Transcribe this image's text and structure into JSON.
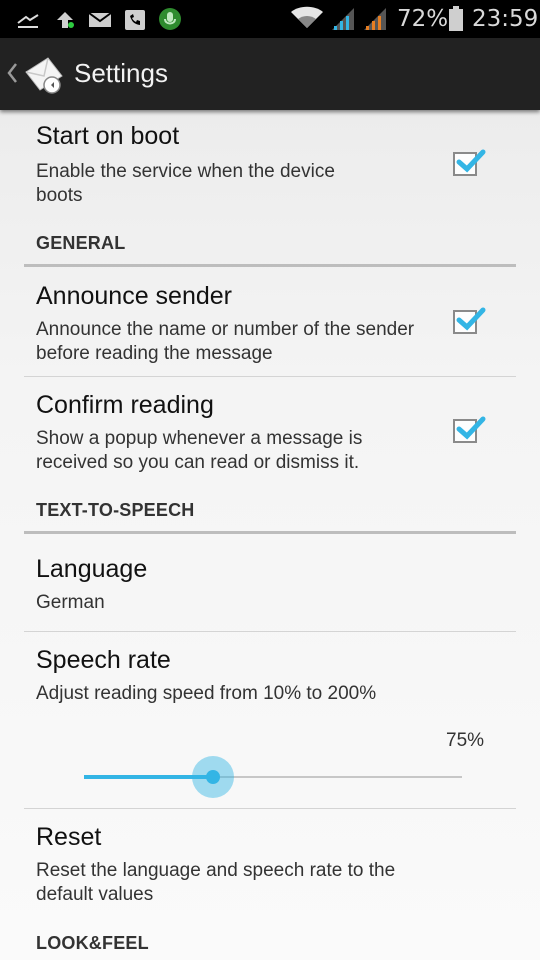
{
  "status_bar": {
    "battery": "72%",
    "time": "23:59",
    "icons": [
      "usb-icon",
      "upload-icon",
      "mail-icon",
      "voicemail-icon",
      "mic-icon",
      "wifi-icon",
      "signal-icon",
      "signal-icon",
      "battery-icon"
    ]
  },
  "action_bar": {
    "title": "Settings",
    "icons": [
      "back-chevron-icon",
      "app-logo-icon"
    ]
  },
  "preferences": {
    "start_on_boot": {
      "title": "Start on boot",
      "summary": "Enable the service when the device boots",
      "checked": true
    },
    "general_header": "GENERAL",
    "announce_sender": {
      "title": "Announce sender",
      "summary": "Announce the name or number of the sender before reading the message",
      "checked": true
    },
    "confirm_reading": {
      "title": "Confirm reading",
      "summary": "Show a popup whenever a message is received so you can read or dismiss it.",
      "checked": true
    },
    "tts_header": "TEXT-TO-SPEECH",
    "language": {
      "title": "Language",
      "summary": "German"
    },
    "speech_rate": {
      "title": "Speech rate",
      "summary": "Adjust reading speed from 10% to 200%",
      "value_label": "75%",
      "slider_fraction": 0.34
    },
    "reset": {
      "title": "Reset",
      "summary": "Reset the language and speech rate to the default values"
    },
    "look_header": "LOOK&FEEL"
  },
  "colors": {
    "accent": "#33b5e5",
    "action_bar": "#222222",
    "status_bar": "#000000"
  }
}
